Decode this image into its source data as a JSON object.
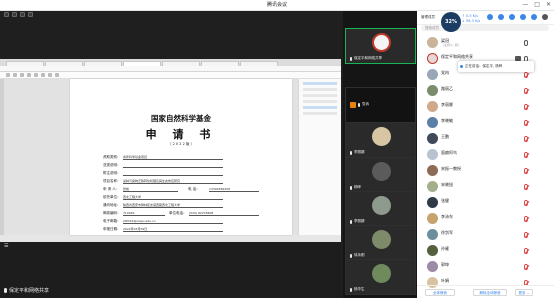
{
  "window": {
    "title": "腾讯会议",
    "controls": [
      "—",
      "□",
      "✕"
    ]
  },
  "top_left_icons": [
    "grid-icon",
    "info-icon",
    "shield-icon",
    "signal-icon"
  ],
  "browser": {
    "tabs": [
      "",
      "",
      "",
      "",
      "",
      "",
      "",
      ""
    ]
  },
  "document": {
    "title_line1": "国家自然科学基金",
    "title_line2": "申 请 书",
    "year": "（ 2 0 2 2 版 ）",
    "fields": [
      {
        "label": "资助类别：",
        "value": "青年科学基金项目"
      },
      {
        "label": "亚类说明：",
        "value": ""
      },
      {
        "label": "附注说明：",
        "value": ""
      },
      {
        "label": "项目名称：",
        "value": "某种污染物迁移转化机理及其生态效应研究"
      },
      {
        "label": "申 请 人：",
        "value": "张峰",
        "extra_label": "电 话：",
        "extra_value": "13309389208"
      },
      {
        "label": "依托单位：",
        "value": "西北工程大学"
      },
      {
        "label": "通讯地址：",
        "value": "陕西省西安市碑林区友谊西路西北工程大学"
      },
      {
        "label": "邮政编码：",
        "value": "710049",
        "extra_label": "单位电话：",
        "extra_value": "(029) 82278608"
      },
      {
        "label": "电子邮箱：",
        "value": "zf2022@nwpu.edu.cn"
      },
      {
        "label": "申报日期：",
        "value": "2022年03月09日"
      }
    ]
  },
  "share_bottom": {
    "speaker": "保定平和网络共享"
  },
  "videos": [
    {
      "name": "保定平和网络共享"
    },
    {
      "name": "党冉"
    },
    {
      "name": "李丽娜"
    },
    {
      "name": "杨晔"
    },
    {
      "name": "李丽娜"
    },
    {
      "name": "徐永刚"
    },
    {
      "name": "杨华生"
    }
  ],
  "panel": {
    "header_label": "管理成员",
    "network": {
      "quality": "32%",
      "up": "↑ 0.5 K/s",
      "down": "↓ 56.3 K/s"
    },
    "search_placeholder": "搜索成员",
    "tooltip": "正在讲话：保定平, 杨晔",
    "members": [
      {
        "name": "梁冠",
        "sub": "（主持人, 我）",
        "mic": "on"
      },
      {
        "name": "保定平和网络共享",
        "sub": "",
        "mic": "on"
      },
      {
        "name": "党冉",
        "sub": "",
        "mic": "muted"
      },
      {
        "name": "路丽乙",
        "sub": "",
        "mic": "muted"
      },
      {
        "name": "李丽娜",
        "sub": "",
        "mic": "muted"
      },
      {
        "name": "李晓敏",
        "sub": "",
        "mic": "muted"
      },
      {
        "name": "王鹏",
        "sub": "",
        "mic": "muted"
      },
      {
        "name": "面癖阿鸟",
        "sub": "",
        "mic": "muted"
      },
      {
        "name": "宋振一教授",
        "sub": "",
        "mic": "muted"
      },
      {
        "name": "宋晓旭",
        "sub": "",
        "mic": "muted"
      },
      {
        "name": "张健",
        "sub": "",
        "mic": "muted"
      },
      {
        "name": "李沛东",
        "sub": "",
        "mic": "muted"
      },
      {
        "name": "徐剑军",
        "sub": "",
        "mic": "muted"
      },
      {
        "name": "孙雁",
        "sub": "",
        "mic": "muted"
      },
      {
        "name": "郭坤",
        "sub": "",
        "mic": "muted"
      },
      {
        "name": "叶娟",
        "sub": "",
        "mic": "muted"
      }
    ],
    "footer": {
      "mute_all": "全体静音",
      "unmute_all": "解除全体静音",
      "more": "更多 ⌄"
    }
  },
  "colors": {
    "accent": "#3b87e8",
    "active_speaker": "#18b456",
    "muted": "#e04b4b",
    "background": "#1f1f1f"
  }
}
